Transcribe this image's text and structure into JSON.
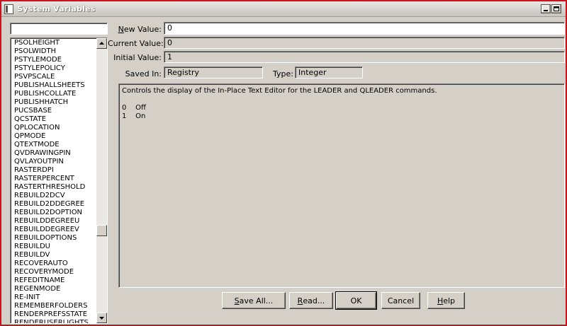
{
  "window": {
    "title": "System Variables",
    "frame_color": "#c8141a"
  },
  "filter": {
    "value": ""
  },
  "variables": [
    "PSOLHEIGHT",
    "PSOLWIDTH",
    "PSTYLEMODE",
    "PSTYLEPOLICY",
    "PSVPSCALE",
    "PUBLISHALLSHEETS",
    "PUBLISHCOLLATE",
    "PUBLISHHATCH",
    "PUCSBASE",
    "QCSTATE",
    "QPLOCATION",
    "QPMODE",
    "QTEXTMODE",
    "QVDRAWINGPIN",
    "QVLAYOUTPIN",
    "RASTERDPI",
    "RASTERPERCENT",
    "RASTERTHRESHOLD",
    "REBUILD2DCV",
    "REBUILD2DDEGREE",
    "REBUILD2DOPTION",
    "REBUILDDEGREEU",
    "REBUILDDEGREEV",
    "REBUILDOPTIONS",
    "REBUILDU",
    "REBUILDV",
    "RECOVERAUTO",
    "RECOVERYMODE",
    "REFEDITNAME",
    "REGENMODE",
    "RE-INIT",
    "REMEMBERFOLDERS",
    "RENDERPREFSSTATE",
    "RENDERUSERLIGHTS"
  ],
  "fields": {
    "new_value": {
      "label_pre": "",
      "label_mn": "N",
      "label_post": "ew Value:",
      "value": "0"
    },
    "current_value": {
      "label": "Current Value:",
      "value": "0"
    },
    "initial_value": {
      "label": "Initial Value:",
      "value": "1"
    },
    "saved_in": {
      "label": "Saved In:",
      "value": "Registry"
    },
    "type": {
      "label": "Type:",
      "value": "Integer"
    }
  },
  "description": [
    "Controls the display of the In-Place Text Editor for the LEADER and QLEADER commands.",
    "",
    "0    Off",
    "1    On"
  ],
  "buttons": {
    "save_all": {
      "pre": "",
      "mn": "S",
      "post": "ave All..."
    },
    "read": {
      "pre": "",
      "mn": "R",
      "post": "ead..."
    },
    "ok": {
      "label": "OK"
    },
    "cancel": {
      "label": "Cancel"
    },
    "help": {
      "pre": "",
      "mn": "H",
      "post": "elp"
    }
  }
}
